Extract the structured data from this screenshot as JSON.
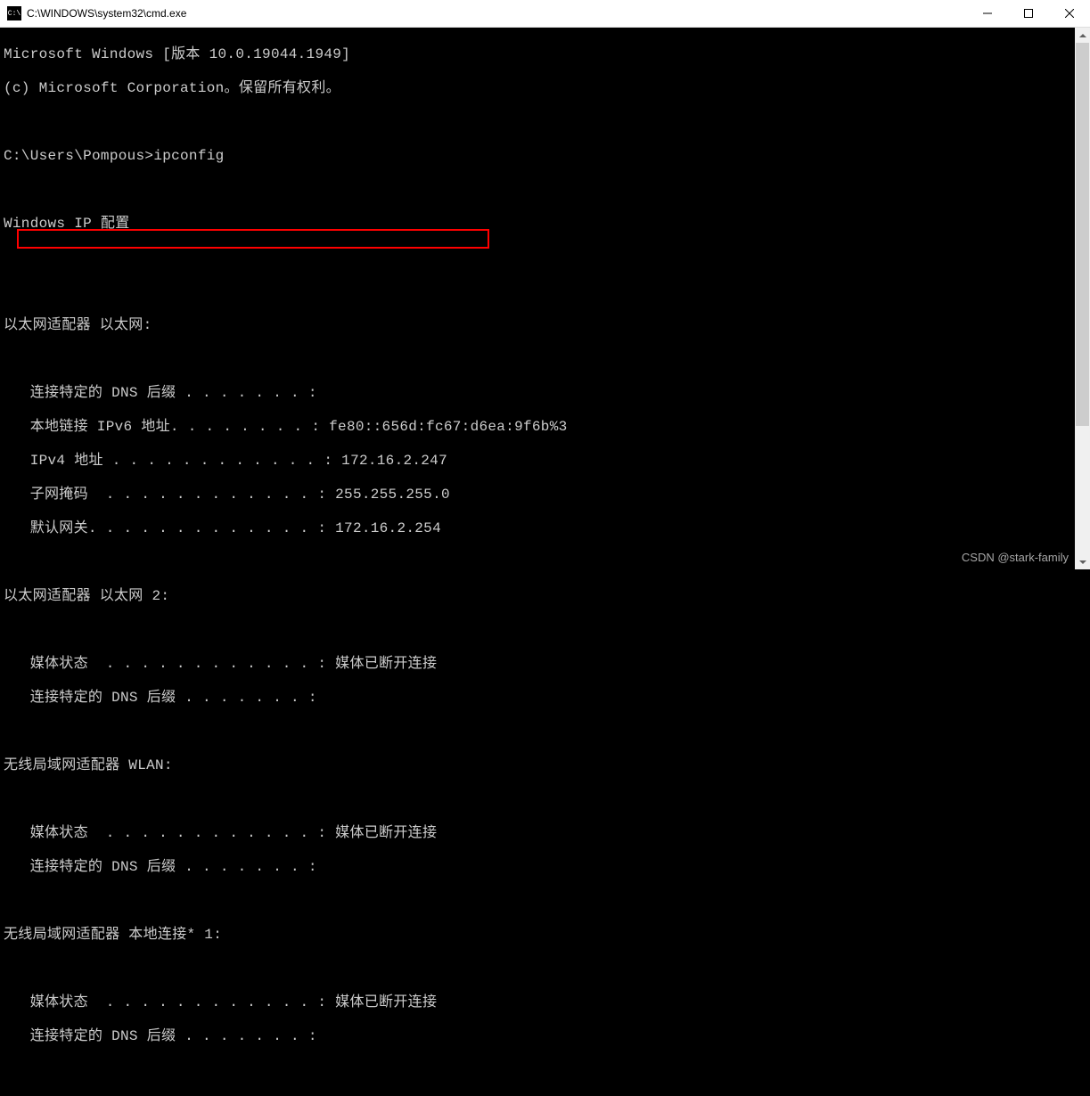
{
  "window": {
    "title": "C:\\WINDOWS\\system32\\cmd.exe"
  },
  "terminal": {
    "header_line1": "Microsoft Windows [版本 10.0.19044.1949]",
    "header_line2": "(c) Microsoft Corporation。保留所有权利。",
    "prompt_path": "C:\\Users\\Pompous>",
    "command": "ipconfig",
    "output_header": "Windows IP 配置",
    "adapters": [
      {
        "title": "以太网适配器 以太网:",
        "lines": [
          {
            "label": "   连接特定的 DNS 后缀 . . . . . . . :",
            "value": ""
          },
          {
            "label": "   本地链接 IPv6 地址. . . . . . . . :",
            "value": " fe80::656d:fc67:d6ea:9f6b%3"
          },
          {
            "label": "   IPv4 地址 . . . . . . . . . . . . :",
            "value": " 172.16.2.247"
          },
          {
            "label": "   子网掩码  . . . . . . . . . . . . :",
            "value": " 255.255.255.0"
          },
          {
            "label": "   默认网关. . . . . . . . . . . . . :",
            "value": " 172.16.2.254"
          }
        ]
      },
      {
        "title": "以太网适配器 以太网 2:",
        "lines": [
          {
            "label": "   媒体状态  . . . . . . . . . . . . :",
            "value": " 媒体已断开连接"
          },
          {
            "label": "   连接特定的 DNS 后缀 . . . . . . . :",
            "value": ""
          }
        ]
      },
      {
        "title": "无线局域网适配器 WLAN:",
        "lines": [
          {
            "label": "   媒体状态  . . . . . . . . . . . . :",
            "value": " 媒体已断开连接"
          },
          {
            "label": "   连接特定的 DNS 后缀 . . . . . . . :",
            "value": ""
          }
        ]
      },
      {
        "title": "无线局域网适配器 本地连接* 1:",
        "lines": [
          {
            "label": "   媒体状态  . . . . . . . . . . . . :",
            "value": " 媒体已断开连接"
          },
          {
            "label": "   连接特定的 DNS 后缀 . . . . . . . :",
            "value": ""
          }
        ]
      }
    ]
  },
  "watermark": "CSDN @stark-family"
}
